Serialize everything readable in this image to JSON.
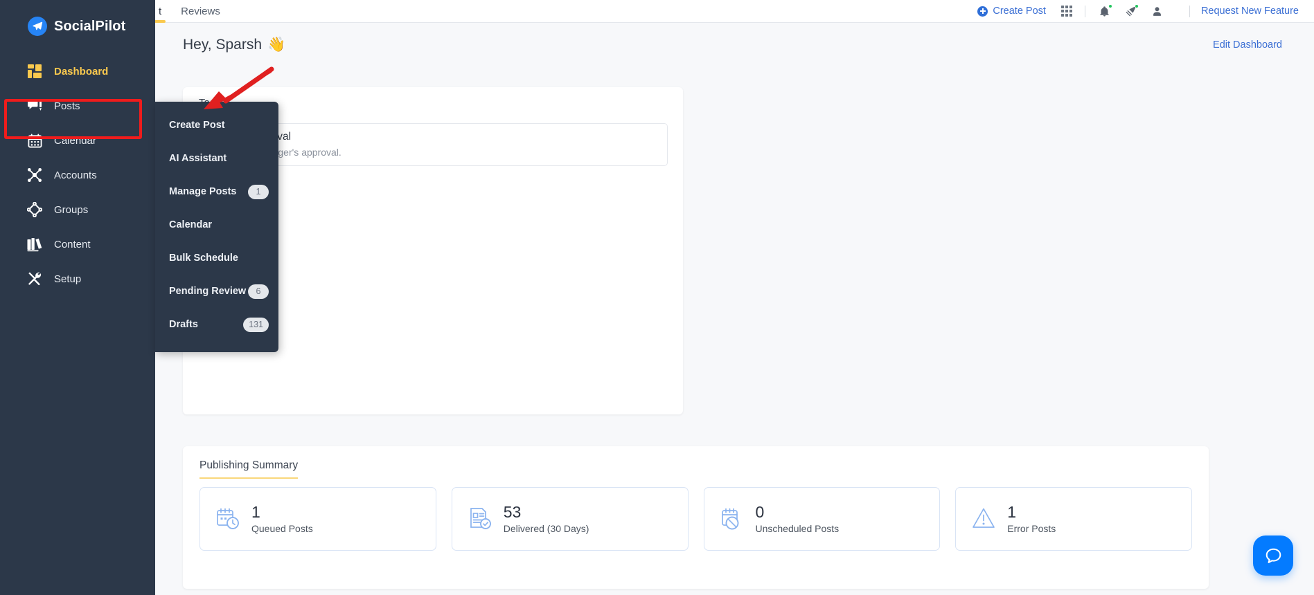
{
  "brand": {
    "name": "SocialPilot",
    "logo_icon": "paper-plane-icon"
  },
  "topbar": {
    "tabs": [
      {
        "label": "t",
        "active": true
      },
      {
        "label": "Reviews",
        "active": false
      }
    ],
    "create_post_label": "Create Post",
    "apps_icon": "grid-apps-icon",
    "notification_icon": "bell-icon",
    "announcement_icon": "megaphone-icon",
    "profile_icon": "user-avatar-icon",
    "request_feature_label": "Request New Feature"
  },
  "sidebar": {
    "items": [
      {
        "label": "Dashboard",
        "icon": "dashboard-grid-icon",
        "active": true
      },
      {
        "label": "Posts",
        "icon": "posts-chat-pencil-icon",
        "active": false
      },
      {
        "label": "Calendar",
        "icon": "calendar-icon",
        "active": false
      },
      {
        "label": "Accounts",
        "icon": "accounts-network-icon",
        "active": false
      },
      {
        "label": "Groups",
        "icon": "groups-diamond-icon",
        "active": false
      },
      {
        "label": "Content",
        "icon": "content-books-icon",
        "active": false
      },
      {
        "label": "Setup",
        "icon": "setup-tools-icon",
        "active": false
      }
    ]
  },
  "flyout": {
    "items": [
      {
        "label": "Create Post",
        "badge": ""
      },
      {
        "label": "AI Assistant",
        "badge": ""
      },
      {
        "label": "Manage Posts",
        "badge": "1"
      },
      {
        "label": "Calendar",
        "badge": ""
      },
      {
        "label": "Bulk Schedule",
        "badge": ""
      },
      {
        "label": "Pending Review",
        "badge": "6"
      },
      {
        "label": "Drafts",
        "badge": "131"
      }
    ]
  },
  "main": {
    "greeting": "Hey, Sparsh",
    "greeting_emoji": "👋",
    "edit_dashboard_label": "Edit Dashboard",
    "tasks": {
      "title": "Tasks",
      "item_title": "require approval",
      "item_subtitle": "nding for Manager's approval."
    },
    "publishing_summary": {
      "title": "Publishing Summary",
      "stats": [
        {
          "value": "1",
          "label": "Queued Posts",
          "icon": "calendar-clock-icon"
        },
        {
          "value": "53",
          "label": "Delivered (30 Days)",
          "icon": "document-check-icon"
        },
        {
          "value": "0",
          "label": "Unscheduled Posts",
          "icon": "calendar-slash-icon"
        },
        {
          "value": "1",
          "label": "Error Posts",
          "icon": "warning-triangle-icon"
        }
      ]
    }
  },
  "chat_widget": {
    "icon": "chat-bubble-icon"
  },
  "annotation": {
    "highlight_color": "#ef1c1c",
    "arrow_color": "#e02020"
  },
  "colors": {
    "sidebar_bg": "#2c3849",
    "accent_yellow": "#fac94e",
    "link_blue": "#3b6fd4",
    "page_bg": "#f7f8fa",
    "stat_icon_blue": "#8ab3ef"
  }
}
